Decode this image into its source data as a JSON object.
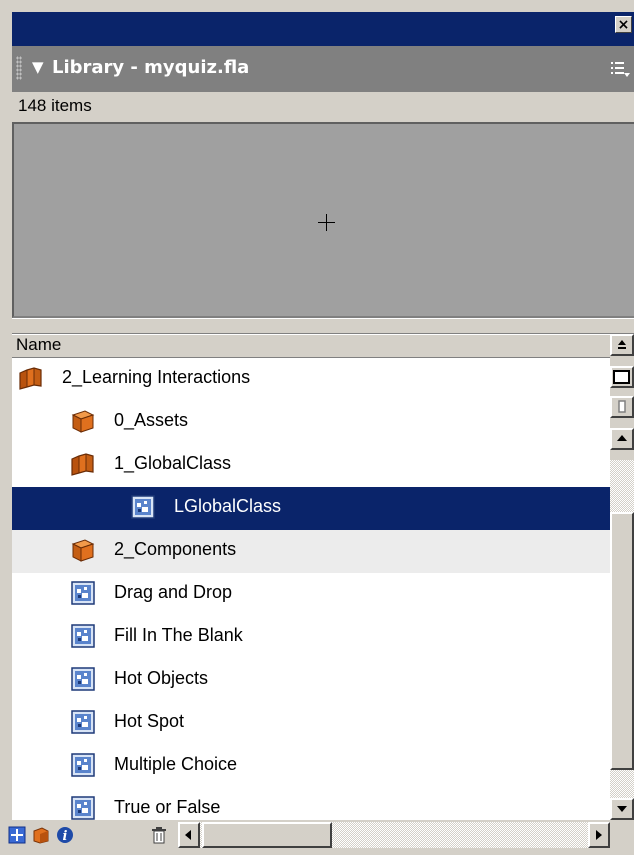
{
  "panel": {
    "title": "Library - myquiz.fla",
    "item_count": "148 items",
    "column_header": "Name"
  },
  "items": [
    {
      "label": "2_Learning Interactions",
      "icon": "folder-open-icon",
      "selected": false,
      "alt": false
    },
    {
      "label": "0_Assets",
      "icon": "folder-closed-icon",
      "selected": false,
      "alt": false
    },
    {
      "label": "1_GlobalClass",
      "icon": "folder-open-icon",
      "selected": false,
      "alt": false
    },
    {
      "label": "LGlobalClass",
      "icon": "component-icon",
      "selected": true,
      "alt": false
    },
    {
      "label": "2_Components",
      "icon": "folder-closed-icon",
      "selected": false,
      "alt": true
    },
    {
      "label": "Drag and Drop",
      "icon": "component-icon",
      "selected": false,
      "alt": false
    },
    {
      "label": "Fill In The Blank",
      "icon": "component-icon",
      "selected": false,
      "alt": false
    },
    {
      "label": "Hot Objects",
      "icon": "component-icon",
      "selected": false,
      "alt": false
    },
    {
      "label": "Hot Spot",
      "icon": "component-icon",
      "selected": false,
      "alt": false
    },
    {
      "label": "Multiple Choice",
      "icon": "component-icon",
      "selected": false,
      "alt": false
    },
    {
      "label": "True or False",
      "icon": "component-icon",
      "selected": false,
      "alt": false
    }
  ],
  "toolbar": {
    "icons": [
      "new-symbol-icon",
      "new-folder-icon",
      "properties-icon",
      "delete-icon"
    ]
  },
  "colors": {
    "title_bar": "#0a246a",
    "selection": "#0a246a",
    "panel_header": "#808080",
    "preview_bg": "#a0a0a0",
    "folder_orange": "#e0701e"
  }
}
